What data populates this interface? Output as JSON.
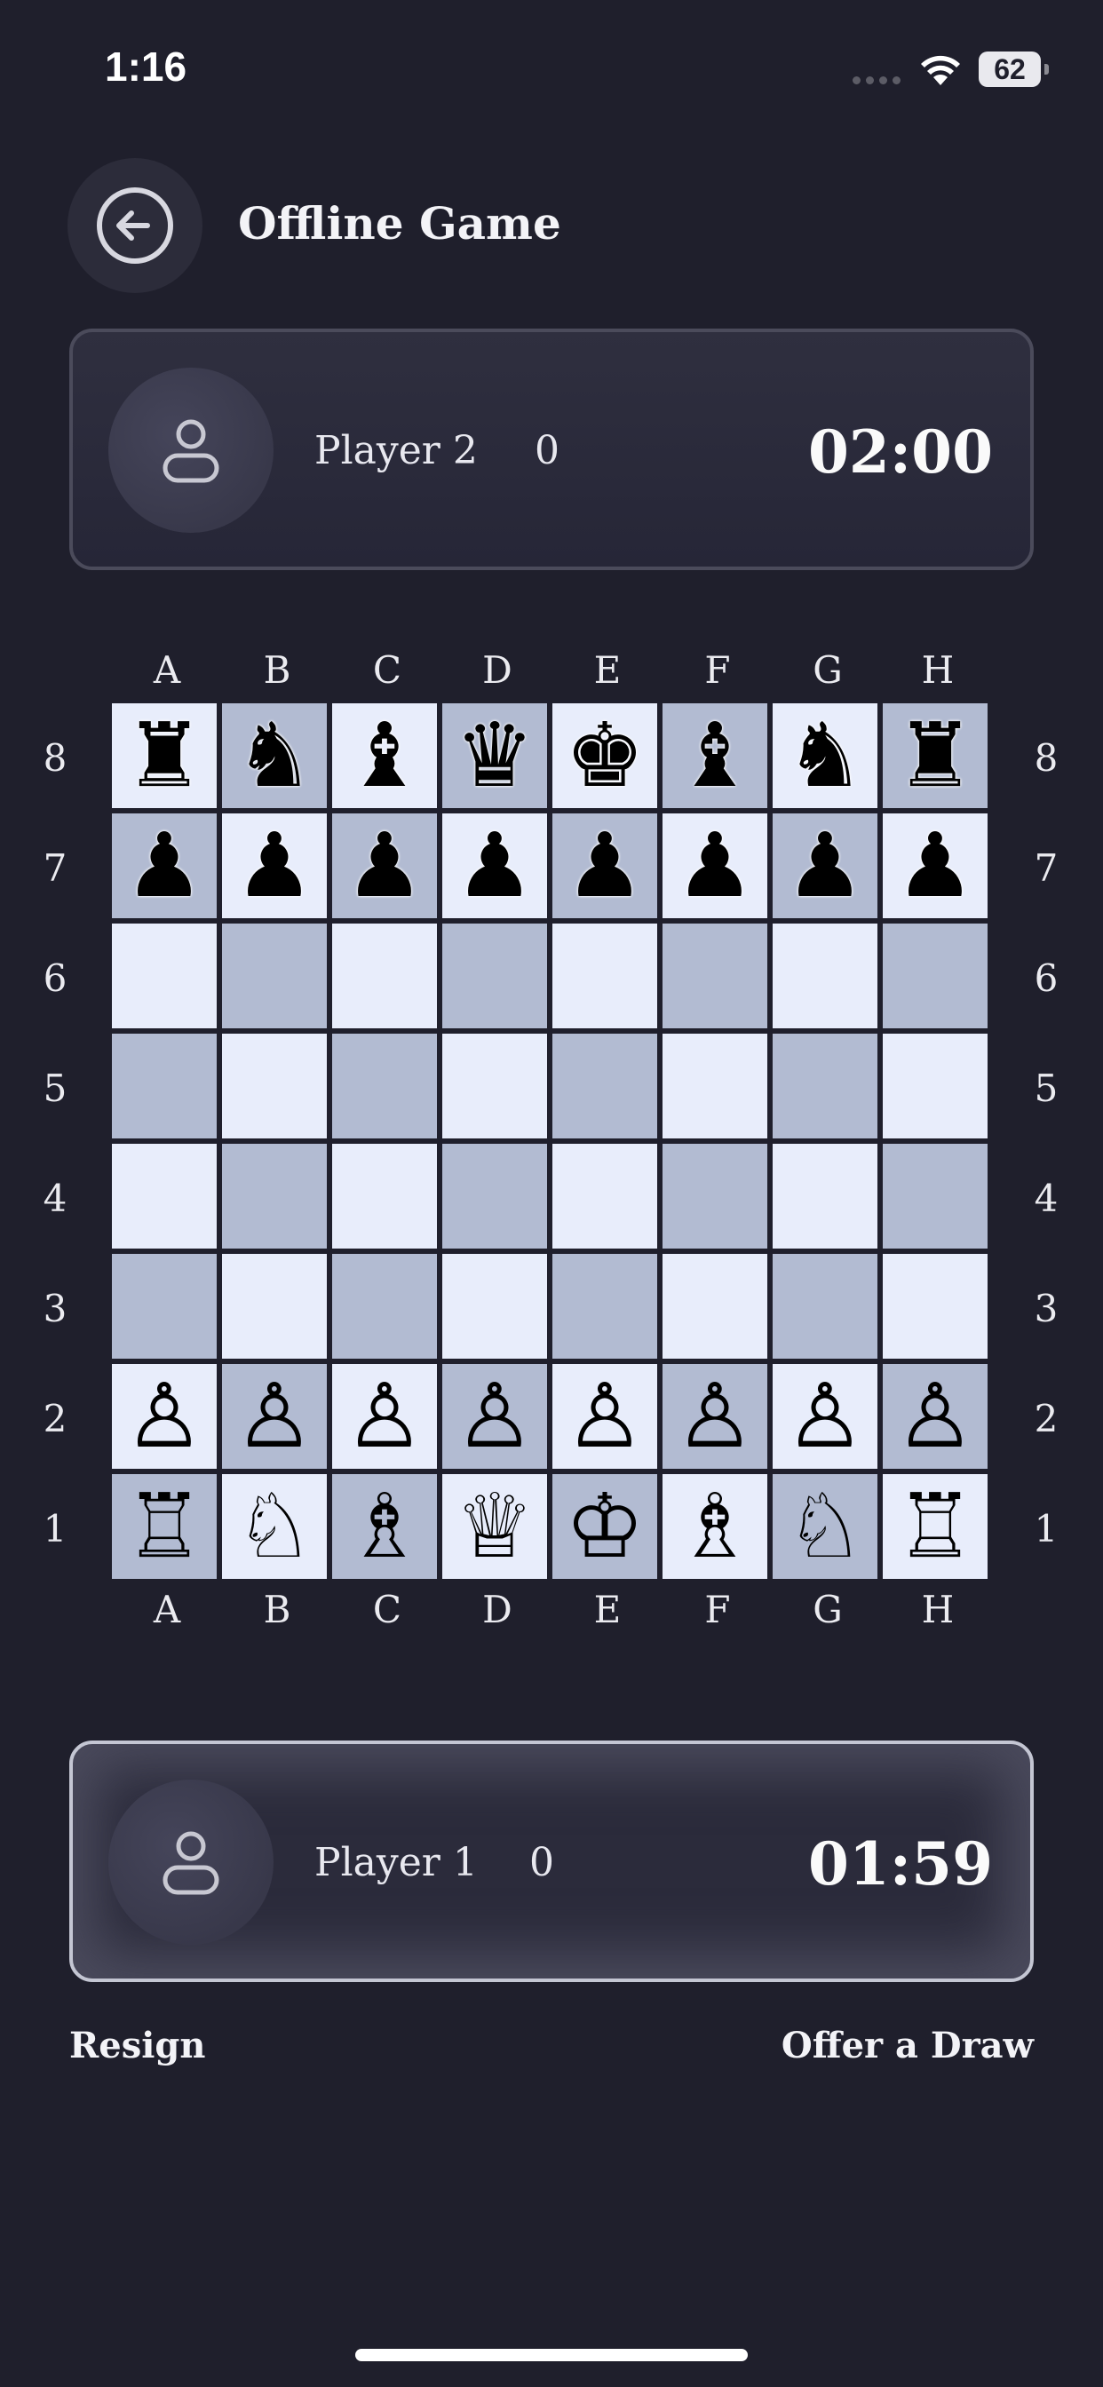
{
  "status_bar": {
    "time": "1:16",
    "battery": "62"
  },
  "header": {
    "title": "Offline Game"
  },
  "opponent": {
    "name": "Player 2",
    "score": "0",
    "clock": "02:00"
  },
  "player": {
    "name": "Player 1",
    "score": "0",
    "clock": "01:59"
  },
  "board": {
    "files": [
      "A",
      "B",
      "C",
      "D",
      "E",
      "F",
      "G",
      "H"
    ],
    "ranks": [
      "8",
      "7",
      "6",
      "5",
      "4",
      "3",
      "2",
      "1"
    ],
    "rows": [
      [
        "♜",
        "♞",
        "♝",
        "♛",
        "♚",
        "♝",
        "♞",
        "♜"
      ],
      [
        "♟",
        "♟",
        "♟",
        "♟",
        "♟",
        "♟",
        "♟",
        "♟"
      ],
      [
        "",
        "",
        "",
        "",
        "",
        "",
        "",
        ""
      ],
      [
        "",
        "",
        "",
        "",
        "",
        "",
        "",
        ""
      ],
      [
        "",
        "",
        "",
        "",
        "",
        "",
        "",
        ""
      ],
      [
        "",
        "",
        "",
        "",
        "",
        "",
        "",
        ""
      ],
      [
        "♙",
        "♙",
        "♙",
        "♙",
        "♙",
        "♙",
        "♙",
        "♙"
      ],
      [
        "♖",
        "♘",
        "♗",
        "♕",
        "♔",
        "♗",
        "♘",
        "♖"
      ]
    ],
    "light_color": "#e8edfb",
    "dark_color": "#b2bbd2"
  },
  "actions": {
    "resign": "Resign",
    "offer_draw": "Offer a Draw"
  }
}
